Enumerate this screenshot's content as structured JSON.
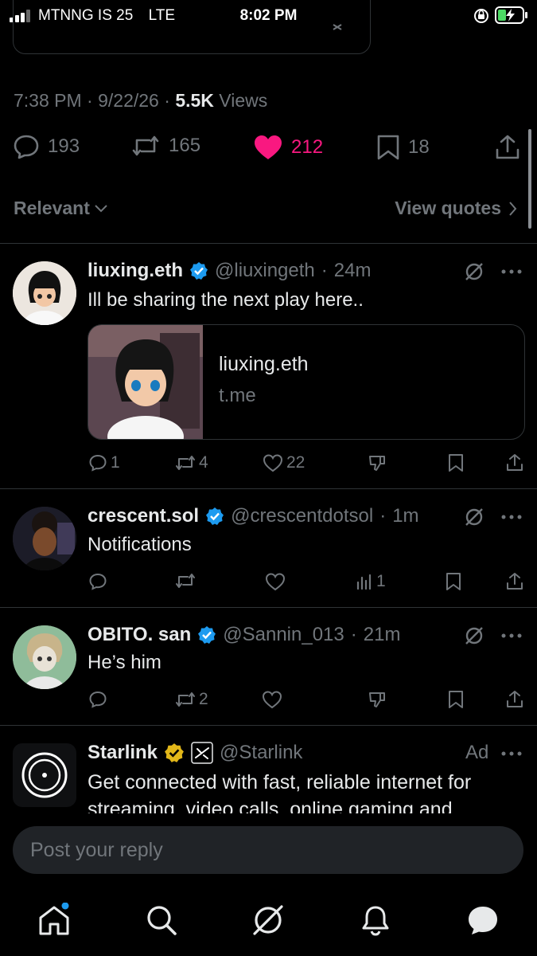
{
  "status_bar": {
    "carrier": "MTNNG IS 25",
    "network": "LTE",
    "time": "8:02 PM"
  },
  "post": {
    "time": "7:38 PM",
    "date": "9/22/26",
    "views_count": "5.5K",
    "views_label": "Views",
    "replies": "193",
    "reposts": "165",
    "likes": "212",
    "bookmarks": "18"
  },
  "sort": {
    "label": "Relevant",
    "view_quotes": "View quotes"
  },
  "replies": [
    {
      "name": "liuxing.eth",
      "handle": "@liuxingeth",
      "time": "24m",
      "text": "Ill be sharing the next play here..",
      "card_title": "liuxing.eth",
      "card_domain": "t.me",
      "reply_count": "1",
      "repost_count": "4",
      "like_count": "22"
    },
    {
      "name": "crescent.sol",
      "handle": "@crescentdotsol",
      "time": "1m",
      "text": "Notifications",
      "views_count": "1"
    },
    {
      "name": "OBITO. san",
      "handle": "@Sannin_013",
      "time": "21m",
      "text": "He’s him",
      "repost_count": "2"
    }
  ],
  "ad": {
    "name": "Starlink",
    "handle": "@Starlink",
    "badge": "Ad",
    "text_line1": "Get connected with fast, reliable internet for",
    "text_line2": "streaming, video calls, online gaming and"
  },
  "composer": {
    "placeholder": "Post your reply"
  },
  "colors": {
    "background": "#000000",
    "like": "#f91880",
    "verified": "#1d9bf0",
    "gold_badge": "#e2b719",
    "secondary_text": "#71767b",
    "divider": "#2f3336"
  },
  "icons": [
    "reply-icon",
    "repost-icon",
    "heart-icon",
    "bookmark-icon",
    "share-icon",
    "grok-icon",
    "more-icon",
    "analytics-icon",
    "home-icon",
    "search-icon",
    "notifications-icon",
    "messages-icon"
  ]
}
